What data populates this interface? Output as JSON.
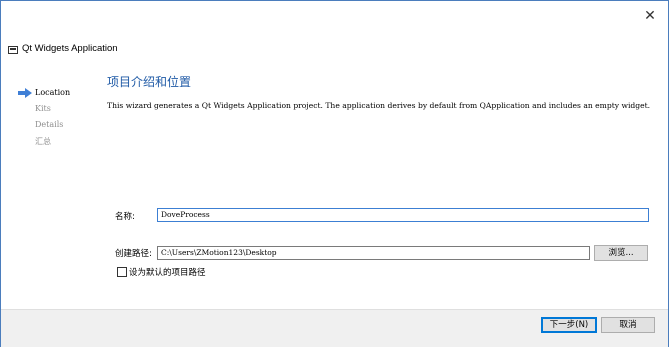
{
  "window": {
    "title": "Qt Widgets Application",
    "close_glyph": "✕"
  },
  "steps": [
    {
      "label": "Location",
      "current": true
    },
    {
      "label": "Kits",
      "current": false
    },
    {
      "label": "Details",
      "current": false
    },
    {
      "label": "汇总",
      "current": false
    }
  ],
  "page": {
    "heading": "项目介绍和位置",
    "description": "This wizard generates a Qt Widgets Application project. The application derives by default from QApplication and includes an empty widget."
  },
  "form": {
    "name_label": "名称:",
    "name_value": "DoveProcess",
    "path_label": "创建路径:",
    "path_value": "C:\\Users\\ZMotion123\\Desktop",
    "browse_label": "浏览...",
    "default_path_label": "设为默认的项目路径",
    "default_path_checked": false
  },
  "footer": {
    "next_label": "下一步(N)",
    "cancel_label": "取消"
  },
  "colors": {
    "accent": "#1f5aa6",
    "border": "#4b7dbd",
    "step_arrow": "#3f7fd6"
  }
}
